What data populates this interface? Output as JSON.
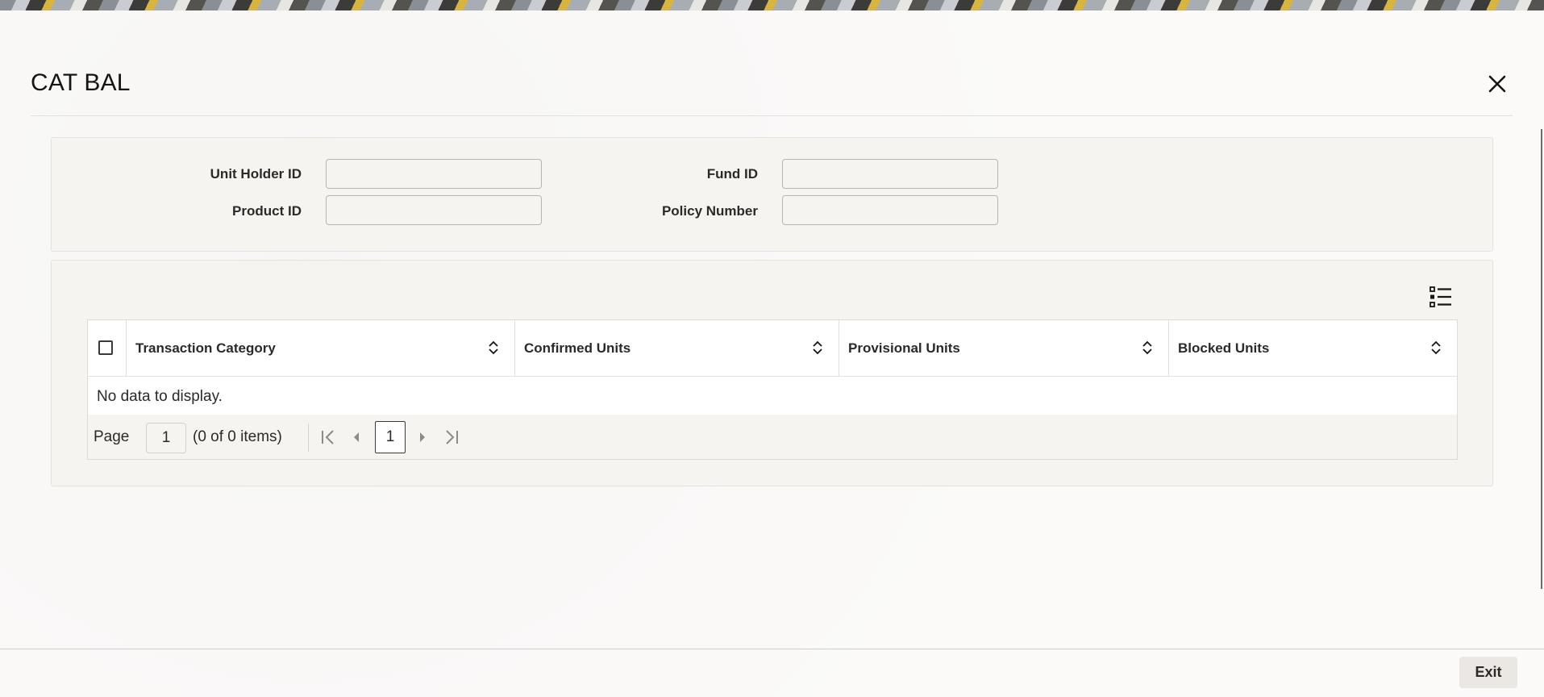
{
  "window": {
    "title": "CAT BAL"
  },
  "form": {
    "unit_holder_id": {
      "label": "Unit Holder ID",
      "value": ""
    },
    "fund_id": {
      "label": "Fund ID",
      "value": ""
    },
    "product_id": {
      "label": "Product ID",
      "value": ""
    },
    "policy_number": {
      "label": "Policy Number",
      "value": ""
    }
  },
  "grid": {
    "columns": [
      {
        "label": "Transaction Category"
      },
      {
        "label": "Confirmed Units"
      },
      {
        "label": "Provisional Units"
      },
      {
        "label": "Blocked Units"
      }
    ],
    "rows": [],
    "empty_message": "No data to display."
  },
  "pagination": {
    "page_label": "Page",
    "page_input": "1",
    "count_text": "(0 of 0 items)",
    "current_page": "1"
  },
  "footer": {
    "exit_label": "Exit"
  },
  "icons": {
    "close": "close-icon",
    "column_picker": "column-picker-icon",
    "sort": "sort-icon",
    "first_page": "first-page-icon",
    "prev_page": "previous-page-icon",
    "next_page": "next-page-icon",
    "last_page": "last-page-icon"
  },
  "colors": {
    "accent_dark": "#161513",
    "panel_bg": "#f6f4f1",
    "page_bg": "#fbfaf9"
  }
}
